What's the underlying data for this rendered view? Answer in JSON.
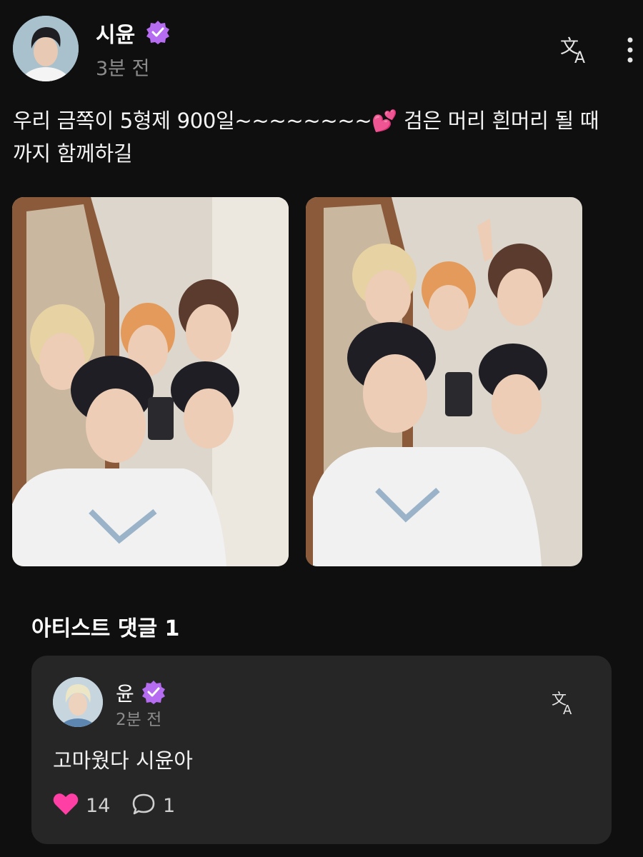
{
  "post": {
    "author": "시윤",
    "time": "3분 전",
    "text": "우리 금쪽이 5형제 900일~~~~~~~~💕 검은 머리 흰머리 될 때\n까지 함께하길",
    "verified_color": "#b56cf0"
  },
  "comments_section": {
    "title": "아티스트 댓글 1"
  },
  "comment": {
    "author": "윤",
    "time": "2분 전",
    "text": "고마웠다 시윤아",
    "likes": "14",
    "replies": "1",
    "like_color": "#ff3fa4"
  },
  "icons": {
    "translate": "translate-icon",
    "more": "more-vertical-icon",
    "verified": "verified-badge-icon",
    "heart": "heart-icon",
    "reply": "comment-bubble-icon"
  }
}
